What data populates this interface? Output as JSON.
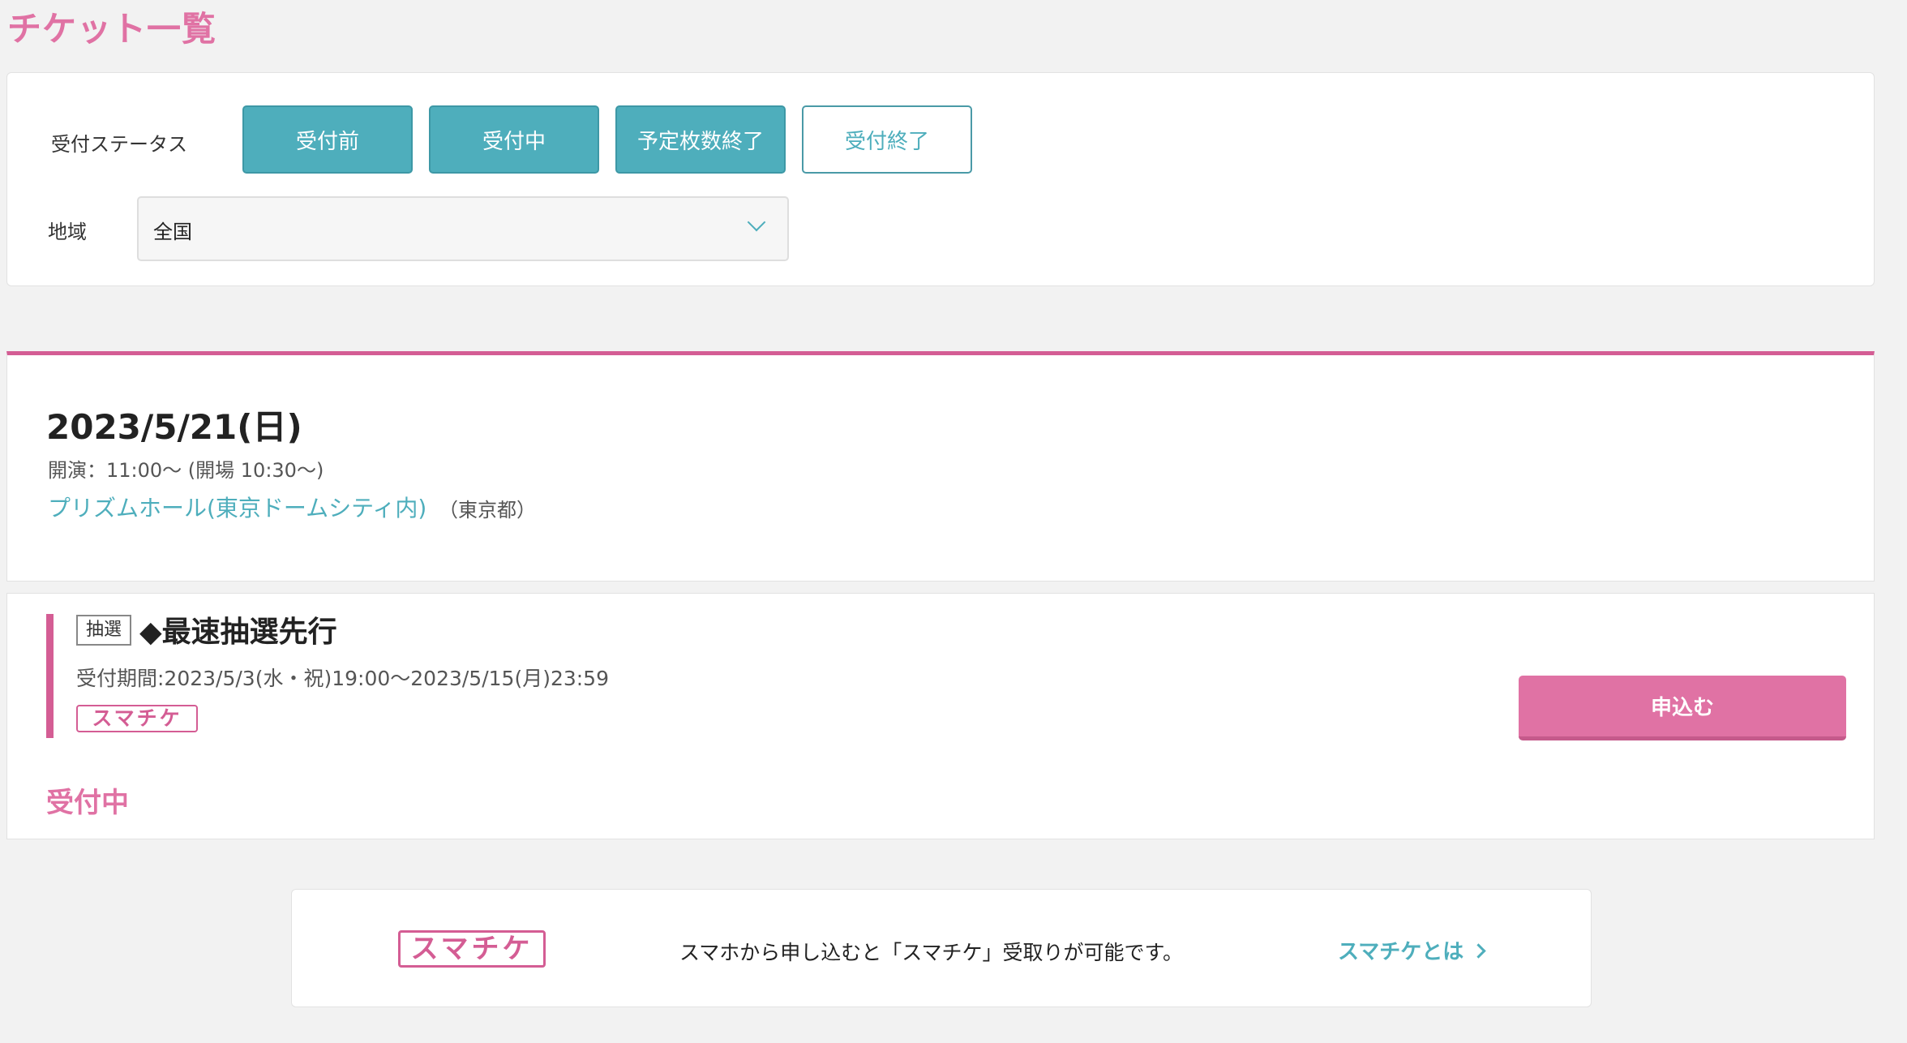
{
  "page": {
    "title": "チケット一覧"
  },
  "filters": {
    "status_label": "受付ステータス",
    "status_buttons": [
      {
        "label": "受付前",
        "state": "active"
      },
      {
        "label": "受付中",
        "state": "active"
      },
      {
        "label": "予定枚数終了",
        "state": "active"
      },
      {
        "label": "受付終了",
        "state": "inactive"
      }
    ],
    "region_label": "地域",
    "region_value": "全国"
  },
  "event": {
    "date": "2023/5/21(日)",
    "time": "開演：11:00〜 (開場 10:30〜)",
    "venue": "プリズムホール(東京ドームシティ内)",
    "prefecture": "（東京都）"
  },
  "ticket": {
    "badge": "抽選",
    "title": "◆最速抽選先行",
    "period": "受付期間:2023/5/3(水・祝)19:00〜2023/5/15(月)23:59",
    "logo_text": "スマチケ",
    "apply_label": "申込む",
    "status": "受付中"
  },
  "info": {
    "logo_text": "スマチケ",
    "text": "スマホから申し込むと「スマチケ」受取りが可能です。",
    "link_label": "スマチケとは"
  },
  "colors": {
    "accent_pink": "#e072a4",
    "accent_teal": "#4eaebc"
  }
}
